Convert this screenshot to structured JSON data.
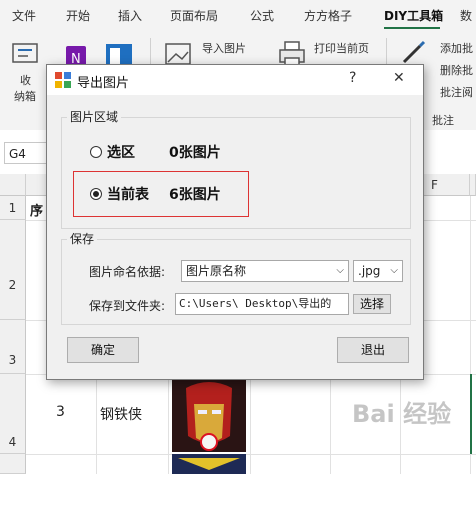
{
  "ribbon": {
    "tabs": [
      "文件",
      "开始",
      "插入",
      "页面布局",
      "公式",
      "方方格子",
      "DIY工具箱",
      "数"
    ],
    "active_tab": "DIY工具箱",
    "buttons": {
      "shou": "收",
      "nazang": "纳箱",
      "insert_picture": "导入图片",
      "print_current": "打印当前页",
      "add_comment": "添加批",
      "delete_comment": "删除批",
      "comment_read": "批注阅",
      "comment_group": "批注"
    }
  },
  "formula_bar": {
    "name_box": "G4"
  },
  "sheet": {
    "columns": [
      "F"
    ],
    "rows": [
      "1",
      "2",
      "3",
      "4"
    ],
    "cells": {
      "a1": "序",
      "row4_num": "3",
      "row4_name": "钢铁侠"
    }
  },
  "dialog": {
    "title": "导出图片",
    "help": "?",
    "close": "✕",
    "region_group": "图片区域",
    "option_selection": "选区",
    "selection_count": "0张图片",
    "option_current_sheet": "当前表",
    "current_sheet_count": "6张图片",
    "save_group": "保存",
    "naming_label": "图片命名依据:",
    "naming_value": "图片原名称",
    "format_value": ".jpg",
    "folder_label": "保存到文件夹:",
    "folder_value": "C:\\Users\\    Desktop\\导出的",
    "browse_button": "选择",
    "ok_button": "确定",
    "exit_button": "退出"
  },
  "watermark": "Bai 经验"
}
